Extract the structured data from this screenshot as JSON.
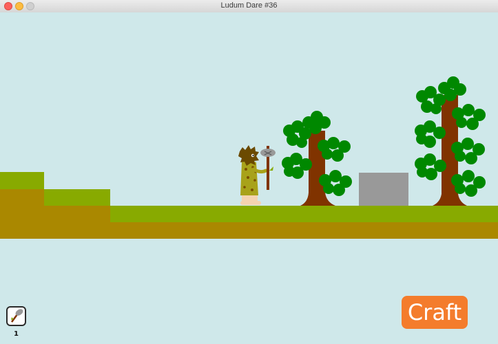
{
  "window": {
    "title": "Ludum Dare #36"
  },
  "inventory": {
    "slot_count": "1"
  },
  "actions": {
    "craft_label": "Craft"
  },
  "colors": {
    "sky": "#cfe8ea",
    "grass": "#88aa00",
    "dirt": "#aa8800",
    "trunk": "#803300",
    "leaves": "#008800",
    "stone": "#999999",
    "craft_button": "#f47c2c"
  }
}
